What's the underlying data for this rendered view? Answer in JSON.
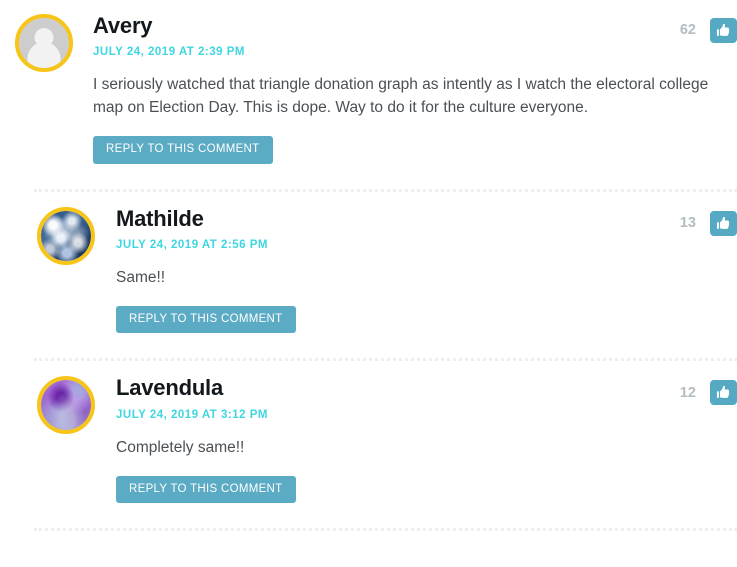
{
  "page": {
    "type": "comment-thread",
    "accent_colors": {
      "avatar_ring": "#F7C518",
      "date_text": "#3ED6E0",
      "button_teal": "#5BABC4",
      "like_button_teal": "#56A9C2",
      "author_text": "#13181C",
      "body_text": "#4B5055",
      "like_count_text": "#B3BCC2",
      "divider": "#ECEEEF"
    }
  },
  "comments": [
    {
      "author": "Avery",
      "date": "JULY 24, 2019 AT 2:39 PM",
      "text": "I seriously watched that triangle donation graph as intently as I watch the electoral college map on Election Day. This is dope. Way to do it for the culture everyone.",
      "reply_label": "REPLY TO THIS COMMENT",
      "like_count": "62",
      "like_icon": "thumbs-up-icon",
      "avatar_type": "default-user-silhouette",
      "indent": "top-level"
    },
    {
      "author": "Mathilde",
      "date": "JULY 24, 2019 AT 2:56 PM",
      "text": "Same!!",
      "reply_label": "REPLY TO THIS COMMENT",
      "like_count": "13",
      "like_icon": "thumbs-up-icon",
      "avatar_type": "cloud-photo",
      "indent": "reply"
    },
    {
      "author": "Lavendula",
      "date": "JULY 24, 2019 AT 3:12 PM",
      "text": "Completely same!!",
      "reply_label": "REPLY TO THIS COMMENT",
      "like_count": "12",
      "like_icon": "thumbs-up-icon",
      "avatar_type": "purple-photo",
      "indent": "reply"
    }
  ]
}
